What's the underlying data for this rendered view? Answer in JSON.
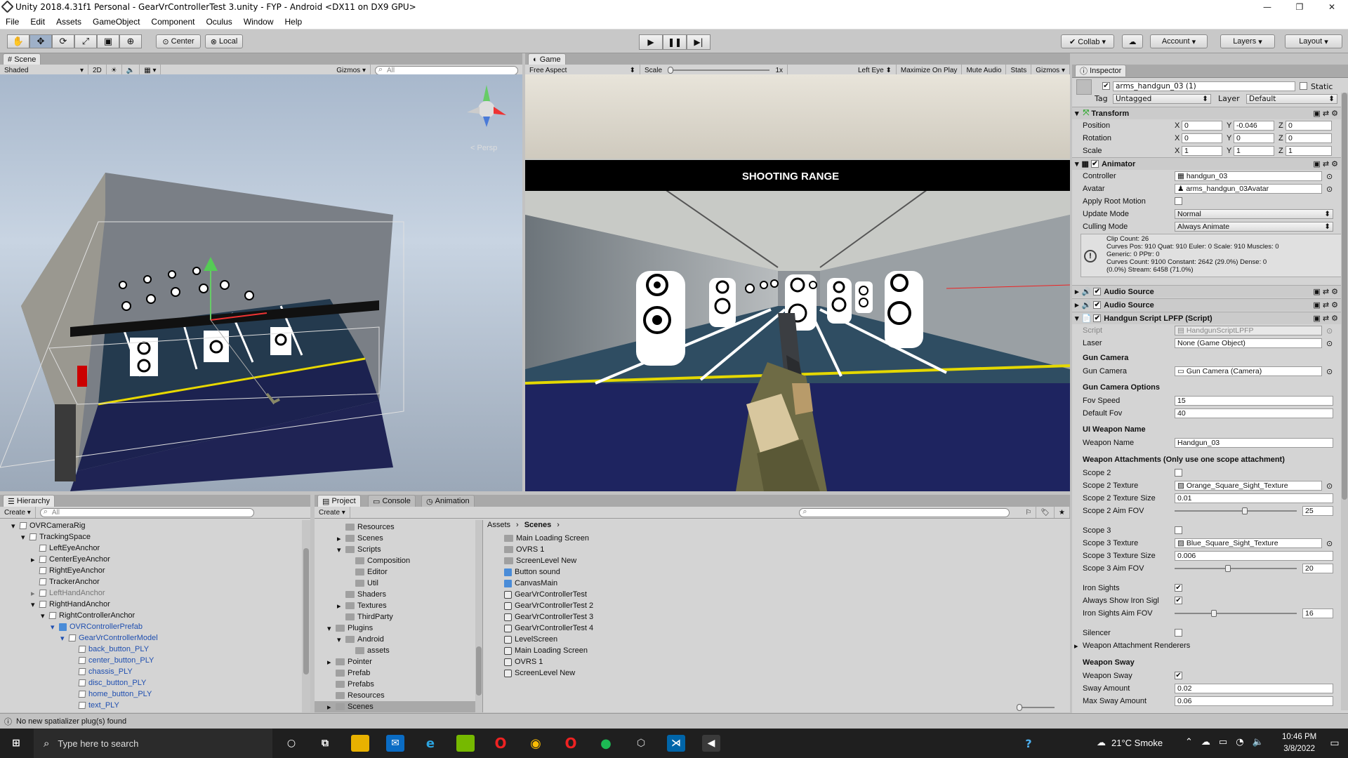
{
  "window": {
    "title": "Unity 2018.4.31f1 Personal - GearVrControllerTest 3.unity - FYP - Android <DX11 on DX9 GPU>"
  },
  "menu": [
    "File",
    "Edit",
    "Assets",
    "GameObject",
    "Component",
    "Oculus",
    "Window",
    "Help"
  ],
  "toolbar": {
    "center": "Center",
    "local": "Local",
    "collab": "Collab ▾",
    "account": "Account",
    "layers": "Layers",
    "layout": "Layout"
  },
  "scene": {
    "tab": "Scene",
    "shading": "Shaded",
    "twod": "2D",
    "gizmos": "Gizmos",
    "search_placeholder": "All",
    "persp": "< Persp"
  },
  "game": {
    "tab": "Game",
    "aspect": "Free Aspect",
    "scale_label": "Scale",
    "scale_value": "1x",
    "left_eye": "Left Eye",
    "maximize": "Maximize On Play",
    "mute": "Mute Audio",
    "stats": "Stats",
    "gizmos": "Gizmos",
    "banner": "SHOOTING RANGE"
  },
  "inspector": {
    "tab": "Inspector",
    "object_name": "arms_handgun_03 (1)",
    "static": "Static",
    "tag_label": "Tag",
    "tag": "Untagged",
    "layer_label": "Layer",
    "layer": "Default",
    "transform": {
      "title": "Transform",
      "position_label": "Position",
      "rotation_label": "Rotation",
      "scale_label": "Scale",
      "position": [
        "0",
        "-0.046",
        "0"
      ],
      "rotation": [
        "0",
        "0",
        "0"
      ],
      "scale": [
        "1",
        "1",
        "1"
      ]
    },
    "animator": {
      "title": "Animator",
      "controller_label": "Controller",
      "controller": "handgun_03",
      "avatar_label": "Avatar",
      "avatar": "arms_handgun_03Avatar",
      "root_motion_label": "Apply Root Motion",
      "update_label": "Update Mode",
      "update": "Normal",
      "culling_label": "Culling Mode",
      "culling": "Always Animate",
      "info": [
        "Clip Count: 26",
        "Curves Pos: 910 Quat: 910 Euler: 0 Scale: 910 Muscles: 0",
        "Generic: 0 PPtr: 0",
        "Curves Count: 9100 Constant: 2642 (29.0%) Dense: 0",
        "(0.0%) Stream: 6458 (71.0%)"
      ]
    },
    "audio1": "Audio Source",
    "audio2": "Audio Source",
    "script_comp": {
      "title": "Handgun Script LPFP (Script)",
      "script_label": "Script",
      "script": "HandgunScriptLPFP",
      "laser_label": "Laser",
      "laser": "None (Game Object)",
      "gun_camera_section": "Gun Camera",
      "gun_camera_label": "Gun Camera",
      "gun_camera": "Gun Camera (Camera)",
      "options_section": "Gun Camera Options",
      "fov_speed_label": "Fov Speed",
      "fov_speed": "15",
      "default_fov_label": "Default Fov",
      "default_fov": "40",
      "ui_section": "UI Weapon Name",
      "weapon_name_label": "Weapon Name",
      "weapon_name": "Handgun_03",
      "attach_section": "Weapon Attachments (Only use one scope attachment)",
      "scope2_label": "Scope 2",
      "scope2_tex_label": "Scope 2 Texture",
      "scope2_tex": "Orange_Square_Sight_Texture",
      "scope2_size_label": "Scope 2 Texture Size",
      "scope2_size": "0.01",
      "scope2_fov_label": "Scope 2 Aim FOV",
      "scope2_fov": "25",
      "scope3_label": "Scope 3",
      "scope3_tex_label": "Scope 3 Texture",
      "scope3_tex": "Blue_Square_Sight_Texture",
      "scope3_size_label": "Scope 3 Texture Size",
      "scope3_size": "0.006",
      "scope3_fov_label": "Scope 3 Aim FOV",
      "scope3_fov": "20",
      "iron_label": "Iron Sights",
      "always_iron_label": "Always Show Iron Sigl",
      "iron_fov_label": "Iron Sights Aim FOV",
      "iron_fov": "16",
      "silencer_label": "Silencer",
      "renderers_label": "Weapon Attachment Renderers",
      "sway_section": "Weapon Sway",
      "sway_label": "Weapon Sway",
      "sway_amount_label": "Sway Amount",
      "sway_amount": "0.02",
      "max_sway_label": "Max Sway Amount",
      "max_sway": "0.06"
    }
  },
  "hierarchy": {
    "tab": "Hierarchy",
    "create": "Create",
    "search_placeholder": "All",
    "rows": [
      "OVRCameraRig",
      "TrackingSpace",
      "LeftEyeAnchor",
      "CenterEyeAnchor",
      "RightEyeAnchor",
      "TrackerAnchor",
      "LeftHandAnchor",
      "RightHandAnchor",
      "RightControllerAnchor",
      "OVRControllerPrefab",
      "GearVrControllerModel",
      "back_button_PLY",
      "center_button_PLY",
      "chassis_PLY",
      "disc_button_PLY",
      "home_button_PLY",
      "text_PLY"
    ]
  },
  "project": {
    "tab": "Project",
    "console": "Console",
    "animation": "Animation",
    "create": "Create",
    "tree": [
      "Resources",
      "Scenes",
      "Scripts",
      "Composition",
      "Editor",
      "Util",
      "Shaders",
      "Textures",
      "ThirdParty",
      "Plugins",
      "Android",
      "assets",
      "Pointer",
      "Prefab",
      "Prefabs",
      "Resources",
      "Scenes"
    ],
    "crumb_root": "Assets",
    "crumb_current": "Scenes",
    "files": [
      "Main Loading Screen",
      "OVRS 1",
      "ScreenLevel New",
      "Button sound",
      "CanvasMain",
      "GearVrControllerTest",
      "GearVrControllerTest 2",
      "GearVrControllerTest 3",
      "GearVrControllerTest 4",
      "LevelScreen",
      "Main Loading Screen",
      "OVRS 1",
      "ScreenLevel New"
    ]
  },
  "status": {
    "message": "No new spatializer plug(s) found"
  },
  "taskbar": {
    "search": "Type here to search",
    "weather": "21°C  Smoke",
    "time": "10:46 PM",
    "date": "3/8/2022"
  }
}
